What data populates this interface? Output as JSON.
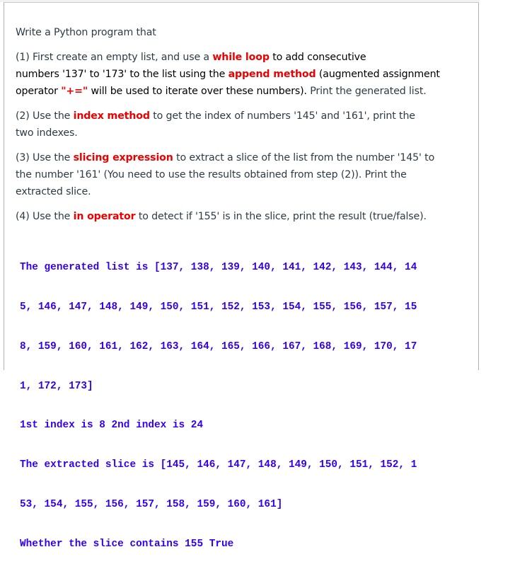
{
  "question": {
    "intro": "Write a Python program that",
    "step1": {
      "p1": "(1) First create an empty list, and use a ",
      "k1": "while loop",
      "p2": " to add consecutive",
      "p3": "numbers '137' to '173' to the list using the ",
      "k2": "append method",
      "p4": " (augmented assignment",
      "p5": "operator ",
      "k3": "\"+=\"",
      "p6": " will be used to iterate over these numbers). ",
      "p7": "Print the generated list."
    },
    "step2": {
      "p1": "(2) Use the ",
      "k1": "index method",
      "p2": " to get the index of numbers '145' and '161', print the two indexes."
    },
    "step3": {
      "p1": "(3) Use the ",
      "k1": "slicing expression",
      "p2": " to extract a slice of the list from the number '145' to the number '161' (You need to use the results obtained from step (2)). Print the extracted slice."
    },
    "step4": {
      "p1": "(4) Use the ",
      "k1": "in operator",
      "p2": " to detect if '155' is in the slice, print the result (true/false)."
    }
  },
  "output": {
    "lines": [
      "The generated list is [137, 138, 139, 140, 141, 142, 143, 144, 14",
      "5, 146, 147, 148, 149, 150, 151, 152, 153, 154, 155, 156, 157, 15",
      "8, 159, 160, 161, 162, 163, 164, 165, 166, 167, 168, 169, 170, 17",
      "1, 172, 173]",
      "1st index is 8 2nd index is 24",
      "The extracted slice is [145, 146, 147, 148, 149, 150, 151, 152, 1",
      "53, 154, 155, 156, 157, 158, 159, 160, 161]",
      "Whether the slice contains 155 True"
    ]
  },
  "colors": {
    "keyword": "#ee0000",
    "console_text": "#3300ee",
    "body_text": "#2d3b45"
  }
}
